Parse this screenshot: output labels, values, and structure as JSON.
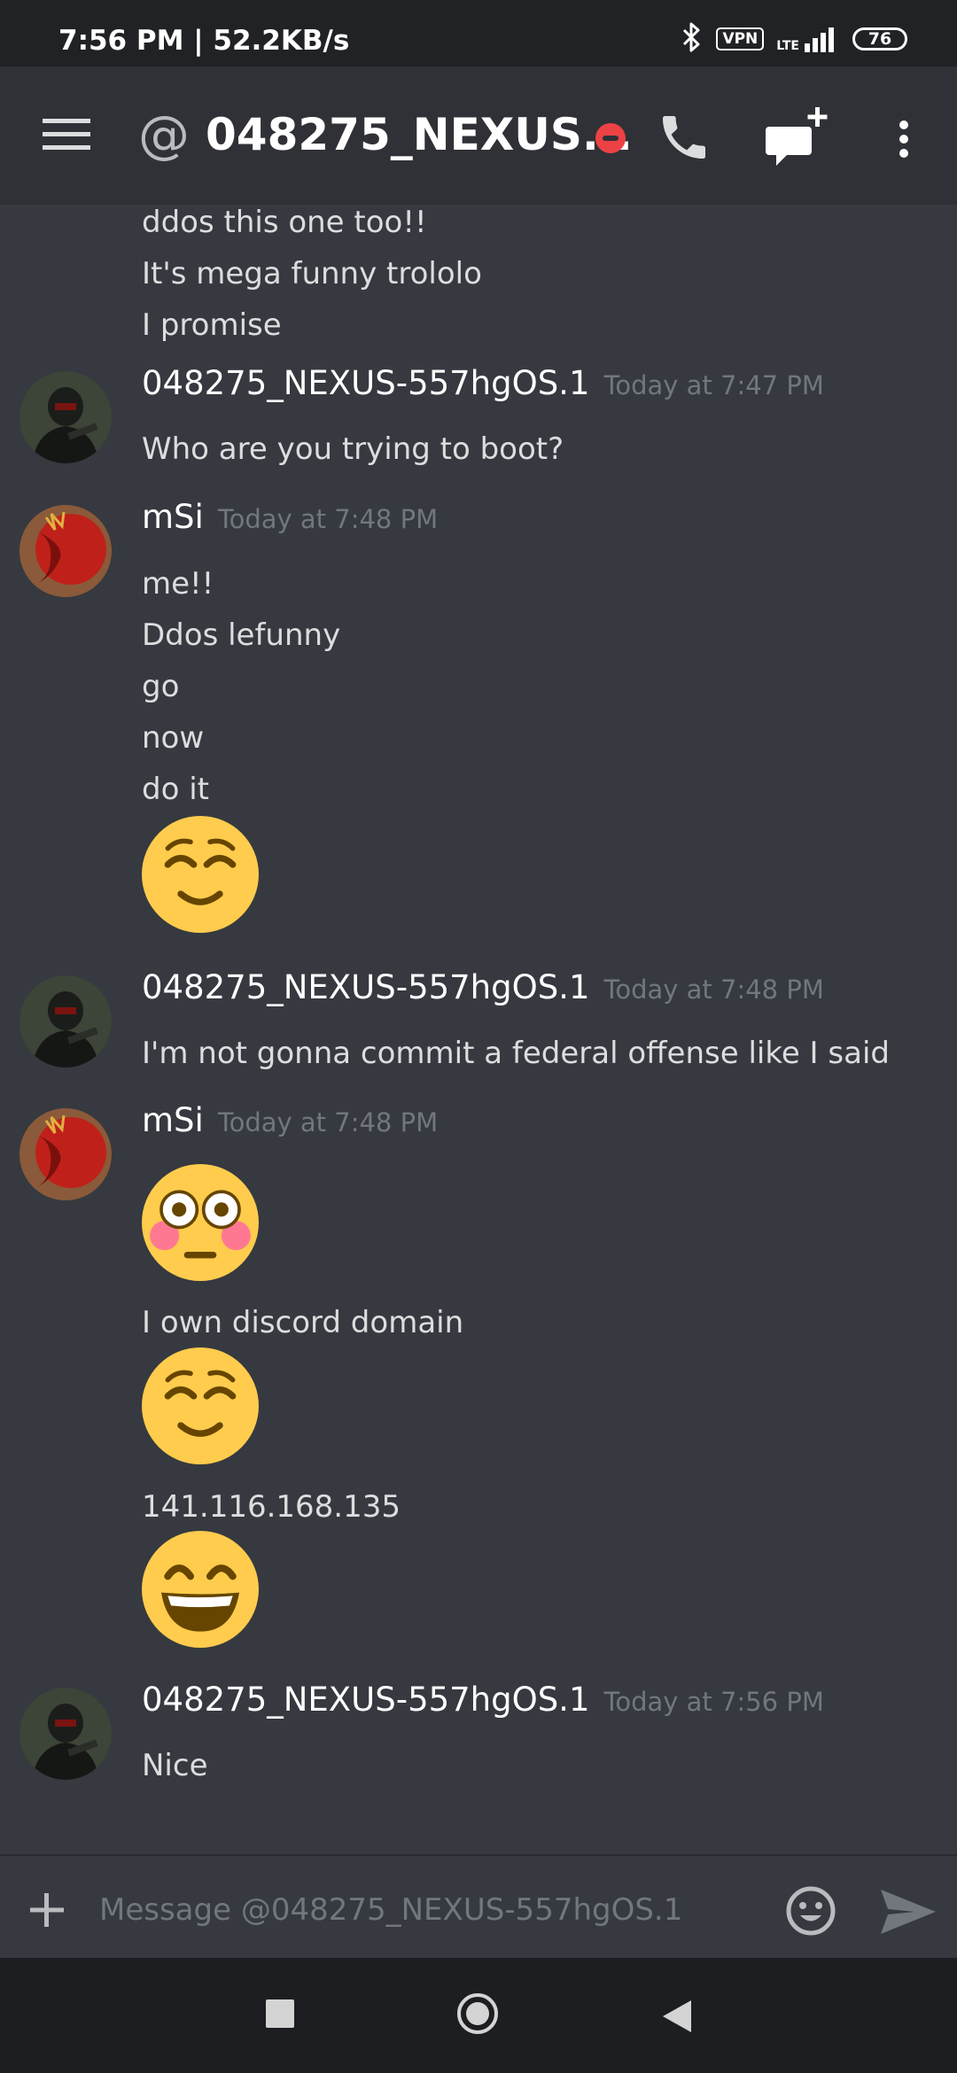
{
  "status_bar": {
    "time": "7:56 PM | 52.2KB/s",
    "vpn": "VPN",
    "lte": "LTE",
    "battery": "76"
  },
  "header": {
    "at_symbol": "@",
    "title": "048275_NEXUS...",
    "status": "dnd",
    "icons": [
      "menu-icon",
      "at-icon",
      "dnd-status-icon",
      "phone-icon",
      "new-dm-icon",
      "more-vertical-icon"
    ]
  },
  "messages": {
    "group0": {
      "lines": [
        "ddos this one too!!",
        "It's mega funny trololo",
        "I promise"
      ]
    },
    "group1": {
      "author": "048275_NEXUS-557hgOS.1",
      "timestamp": "Today at 7:47 PM",
      "lines": [
        "Who are you trying to boot?"
      ]
    },
    "group2": {
      "author": "mSi",
      "timestamp": "Today at 7:48 PM",
      "lines": [
        "me!!",
        "Ddos lefunny",
        "go",
        "now",
        "do it"
      ],
      "emoji": "relieved-face"
    },
    "group3": {
      "author": "048275_NEXUS-557hgOS.1",
      "timestamp": "Today at 7:48 PM",
      "lines": [
        "I'm not gonna commit a federal offense like I said"
      ]
    },
    "group4": {
      "author": "mSi",
      "timestamp": "Today at 7:48 PM",
      "items": [
        "flushed-face",
        "I own discord domain",
        "relieved-face",
        "141.116.168.135",
        "grinning-face"
      ]
    },
    "group5": {
      "author": "048275_NEXUS-557hgOS.1",
      "timestamp": "Today at 7:56 PM",
      "lines": [
        "Nice"
      ]
    }
  },
  "composer": {
    "placeholder": "Message @048275_NEXUS-557hgOS.1",
    "value": ""
  },
  "colors": {
    "background": "#36393f",
    "header": "#2f3136",
    "statusbar": "#202225",
    "navbar": "#1d1e21",
    "dnd": "#ed4245",
    "emoji_yellow": "#ffcc4d"
  }
}
